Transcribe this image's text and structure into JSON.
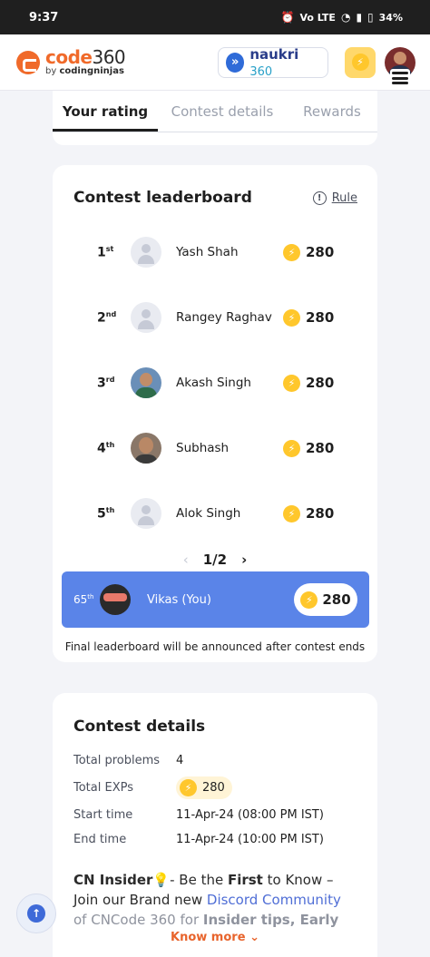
{
  "status": {
    "time": "9:37",
    "battery": "34%",
    "net": "Vo LTE"
  },
  "header": {
    "logo_main": "code",
    "logo_num": "360",
    "logo_by": "by ",
    "logo_brand": "codingninjas",
    "naukri": "naukri",
    "naukri_num": "360"
  },
  "tabs": [
    "Your rating",
    "Contest details",
    "Rewards"
  ],
  "leaderboard": {
    "title": "Contest leaderboard",
    "rule_label": "Rule",
    "rows": [
      {
        "rank": "1",
        "suffix": "st",
        "name": "Yash Shah",
        "points": "280"
      },
      {
        "rank": "2",
        "suffix": "nd",
        "name": "Rangey Raghav",
        "points": "280"
      },
      {
        "rank": "3",
        "suffix": "rd",
        "name": "Akash Singh",
        "points": "280"
      },
      {
        "rank": "4",
        "suffix": "th",
        "name": "Subhash",
        "points": "280"
      },
      {
        "rank": "5",
        "suffix": "th",
        "name": "Alok Singh",
        "points": "280"
      }
    ],
    "page": "1/2",
    "you": {
      "rank": "65",
      "suffix": "th",
      "name": "Vikas (You)",
      "points": "280"
    },
    "note": "Final leaderboard will be announced after contest ends"
  },
  "contest_details": {
    "title": "Contest details",
    "rows": [
      {
        "label": "Total problems",
        "value": "4"
      },
      {
        "label": "Total EXPs",
        "value": "280"
      },
      {
        "label": "Start time",
        "value": "11-Apr-24 (08:00 PM IST)"
      },
      {
        "label": "End time",
        "value": "11-Apr-24 (10:00 PM IST)"
      }
    ],
    "insider": {
      "part1": "CN Insider",
      "part2": "- Be the ",
      "part3": "First",
      "part4": " to Know – Join our Brand new ",
      "link": "Discord Community",
      "part5": " of CNCode 360 for ",
      "part6": "Insider tips, Early"
    },
    "know_more": "Know more"
  },
  "colors": {
    "accent": "#f06a2a",
    "you_bar": "#5a84e8",
    "coin": "#ffc72c"
  }
}
